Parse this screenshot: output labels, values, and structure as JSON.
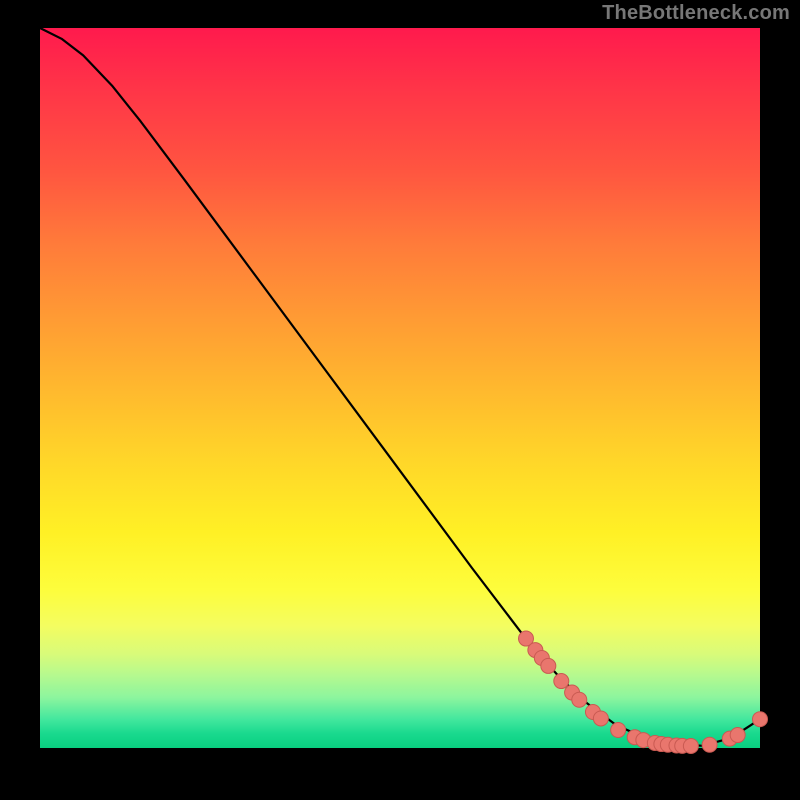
{
  "attribution": "TheBottleneck.com",
  "colors": {
    "marker_fill": "#e9766d",
    "marker_stroke": "#c95a52",
    "curve": "#000000"
  },
  "chart_data": {
    "type": "line",
    "title": "",
    "xlabel": "",
    "ylabel": "",
    "xlim": [
      0,
      100
    ],
    "ylim": [
      0,
      100
    ],
    "grid": false,
    "legend": false,
    "curve": [
      {
        "x": 0,
        "y": 100
      },
      {
        "x": 3,
        "y": 98.5
      },
      {
        "x": 6,
        "y": 96.2
      },
      {
        "x": 10,
        "y": 92.0
      },
      {
        "x": 14,
        "y": 87.0
      },
      {
        "x": 20,
        "y": 79.0
      },
      {
        "x": 30,
        "y": 65.5
      },
      {
        "x": 40,
        "y": 52.0
      },
      {
        "x": 50,
        "y": 38.5
      },
      {
        "x": 60,
        "y": 25.0
      },
      {
        "x": 68,
        "y": 14.5
      },
      {
        "x": 72,
        "y": 10.0
      },
      {
        "x": 76,
        "y": 6.2
      },
      {
        "x": 80,
        "y": 3.2
      },
      {
        "x": 84,
        "y": 1.4
      },
      {
        "x": 88,
        "y": 0.6
      },
      {
        "x": 92,
        "y": 0.3
      },
      {
        "x": 96,
        "y": 1.4
      },
      {
        "x": 100,
        "y": 4.0
      }
    ],
    "markers": [
      {
        "x": 67.5,
        "y": 15.2
      },
      {
        "x": 68.8,
        "y": 13.6
      },
      {
        "x": 69.7,
        "y": 12.5
      },
      {
        "x": 70.6,
        "y": 11.4
      },
      {
        "x": 72.4,
        "y": 9.3
      },
      {
        "x": 73.9,
        "y": 7.7
      },
      {
        "x": 74.9,
        "y": 6.7
      },
      {
        "x": 76.8,
        "y": 5.0
      },
      {
        "x": 77.9,
        "y": 4.1
      },
      {
        "x": 80.3,
        "y": 2.5
      },
      {
        "x": 82.6,
        "y": 1.5
      },
      {
        "x": 83.8,
        "y": 1.1
      },
      {
        "x": 85.4,
        "y": 0.7
      },
      {
        "x": 86.3,
        "y": 0.55
      },
      {
        "x": 87.2,
        "y": 0.45
      },
      {
        "x": 88.4,
        "y": 0.35
      },
      {
        "x": 89.2,
        "y": 0.3
      },
      {
        "x": 90.4,
        "y": 0.28
      },
      {
        "x": 93.0,
        "y": 0.45
      },
      {
        "x": 95.8,
        "y": 1.3
      },
      {
        "x": 96.9,
        "y": 1.8
      },
      {
        "x": 100.0,
        "y": 4.0
      }
    ]
  }
}
